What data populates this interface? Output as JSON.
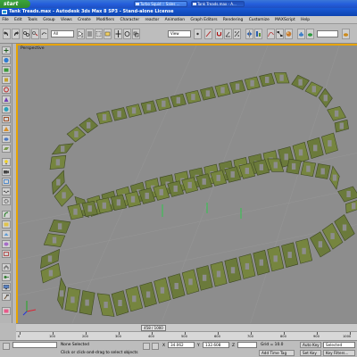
{
  "taskbar": {
    "start_label": "start",
    "tasks": [
      {
        "label": "Turbo Squid :: Sales ..."
      },
      {
        "label": "Tank Treads.max - A..."
      }
    ]
  },
  "window": {
    "title": "Tank Treads.max - Autodesk 3ds Max 8 SP3 - Stand-alone License"
  },
  "menu": {
    "items": [
      "File",
      "Edit",
      "Tools",
      "Group",
      "Views",
      "Create",
      "Modifiers",
      "Character",
      "reactor",
      "Animation",
      "Graph Editors",
      "Rendering",
      "Customize",
      "MAXScript",
      "Help"
    ]
  },
  "toolbar": {
    "selection_filter": "All",
    "reference_coord": "View"
  },
  "viewport": {
    "label": "Perspective",
    "object_color": "#6b7a3b",
    "object_shadow_color": "#3e4922",
    "background_color": "#8d8d8d",
    "active_border_color": "#e8a400"
  },
  "timeslider": {
    "frame_readout": "458 / 1000"
  },
  "trackbar": {
    "ticks": [
      "0",
      "100",
      "200",
      "300",
      "400",
      "500",
      "600",
      "700",
      "800",
      "900",
      "1000"
    ]
  },
  "status": {
    "selection": "None Selected",
    "prompt": "Click or click-and-drag to select objects",
    "x_label": "X",
    "x_value": "34.062",
    "y_label": "Y",
    "y_value": "132.608",
    "z_label": "Z",
    "grid": "Grid = 10.0",
    "add_time_tag": "Add Time Tag",
    "auto_key": "Auto Key",
    "set_key": "Set Key",
    "selected_mode": "Selected",
    "key_filters": "Key Filters..."
  }
}
